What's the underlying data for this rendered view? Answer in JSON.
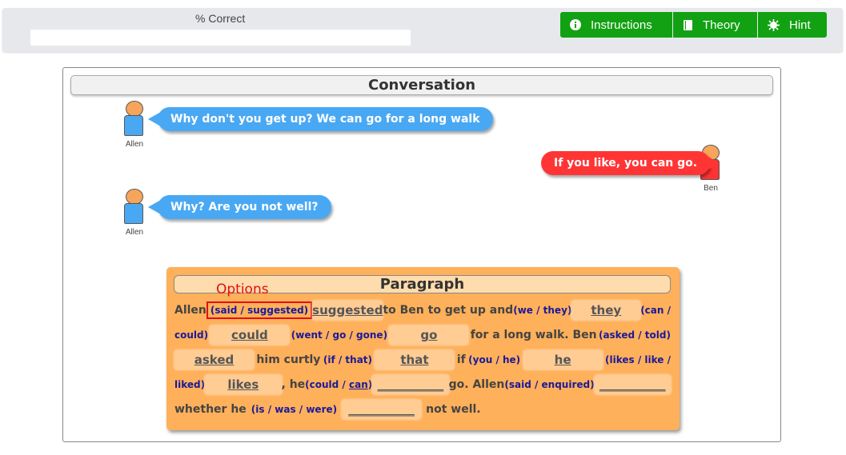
{
  "header": {
    "progress_label": "% Correct",
    "progress_value": 0,
    "buttons": {
      "instructions": "Instructions",
      "theory": "Theory",
      "hint": "Hint"
    }
  },
  "conversation": {
    "title": "Conversation",
    "messages": [
      {
        "speaker": "Allen",
        "text": "Why don't you get up? We can go for a long walk",
        "color": "#49a8f3"
      },
      {
        "speaker": "Ben",
        "text": "If you like, you can go.",
        "color": "#ff3535"
      },
      {
        "speaker": "Allen",
        "text": "Why? Are you not well?",
        "color": "#49a8f3"
      }
    ]
  },
  "paragraph": {
    "title": "Paragraph",
    "options_label": "Options",
    "words": {
      "allen1": "Allen",
      "to_ben": "to Ben to get up and",
      "for_walk": "for a long walk. Ben",
      "curtly": "him curtly",
      "if": "if",
      "he": ", he",
      "go_allen": "go. Allen",
      "whether": "whether he",
      "notwell": "not well."
    },
    "options": {
      "o1": "(said / suggested)",
      "o2": "(we / they)",
      "o3a": "(can /",
      "o3b": "could)",
      "o4": "(went / go / gone)",
      "o5": "(asked / told)",
      "o6": "(if / that)",
      "o7": "(you / he)",
      "o8a": "(likes / like /",
      "o8b": "liked)",
      "o9_pre": "(could / ",
      "o9_u": "can",
      "o9_post": ")",
      "o10": "(said / enquired)",
      "o11": "(is / was / were)"
    },
    "answers": {
      "a1": "suggested",
      "a2": "they",
      "a3": "could",
      "a4": "go",
      "a5": "asked",
      "a6": "that",
      "a7": "he",
      "a8": "likes",
      "a9": "___________",
      "a10": "___________",
      "a11": "___________"
    }
  },
  "colors": {
    "button_green": "#12a112",
    "paragraph_bg": "#ffb05a",
    "options_red": "#e01010"
  }
}
